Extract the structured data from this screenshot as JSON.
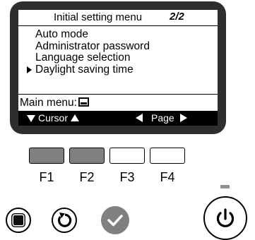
{
  "screen": {
    "title": "Initial setting menu",
    "page_indicator": "2/2",
    "menu_items": [
      {
        "label": "Auto mode",
        "selected": false
      },
      {
        "label": "Administrator password",
        "selected": false
      },
      {
        "label": "Language selection",
        "selected": false
      },
      {
        "label": "Daylight saving time",
        "selected": true
      }
    ],
    "main_menu_label": "Main menu:",
    "softkeys": {
      "cursor_label": "Cursor",
      "page_label": "Page"
    }
  },
  "function_keys": [
    {
      "label": "F1",
      "highlighted": true
    },
    {
      "label": "F2",
      "highlighted": true
    },
    {
      "label": "F3",
      "highlighted": false
    },
    {
      "label": "F4",
      "highlighted": false
    }
  ],
  "buttons": {
    "menu": "menu-icon",
    "return": "return-icon",
    "select": "checkmark-icon",
    "power": "power-icon"
  },
  "colors": {
    "bezel": "#2e2e2e",
    "key_highlight": "#808080",
    "select_button": "#808080"
  }
}
